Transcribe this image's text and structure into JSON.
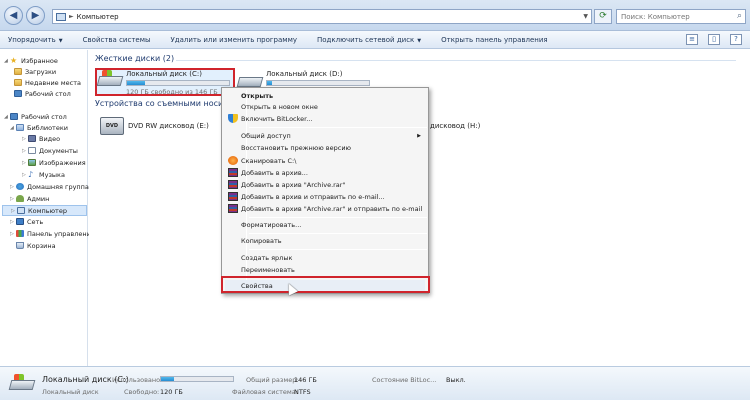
{
  "address_bar": {
    "arrow": "►",
    "path": "Компьютер",
    "search_placeholder": "Поиск: Компьютер"
  },
  "toolbar": {
    "items": [
      {
        "label": "Упорядочить",
        "has_dropdown": true
      },
      {
        "label": "Свойства системы"
      },
      {
        "label": "Удалить или изменить программу"
      },
      {
        "label": "Подключить сетевой диск",
        "has_dropdown": true
      },
      {
        "label": "Открыть панель управления"
      }
    ]
  },
  "sidebar": {
    "favorites": "Избранное",
    "downloads": "Загрузки",
    "recent_places": "Недавние места",
    "desktop_fav": "Рабочий стол",
    "desktop": "Рабочий стол",
    "libraries": "Библиотеки",
    "video": "Видео",
    "documents": "Документы",
    "images": "Изображения",
    "music": "Музыка",
    "homegroup": "Домашняя группа",
    "admin": "Админ",
    "computer": "Компьютер",
    "network": "Сеть",
    "control_panel": "Панель управления",
    "recycle_bin": "Корзина"
  },
  "main": {
    "hard_disks_title": "Жесткие диски (2)",
    "removable_title": "Устройства со съемными носит",
    "drive_c": {
      "name": "Локальный диск (C:)",
      "free_text": "120 ГБ свободно из 146 ГБ",
      "used_fraction": 0.18
    },
    "drive_d": {
      "name": "Локальный диск (D:)",
      "used_fraction": 0.05
    },
    "dvd": {
      "name": "DVD RW дисковод (E:)",
      "badge": "DVD"
    },
    "drive_h_partial": "дисковод (H:)"
  },
  "context_menu": {
    "open": "Открыть",
    "open_new_window": "Открыть в новом окне",
    "bitlocker": "Включить BitLocker...",
    "share": "Общий доступ",
    "restore": "Восстановить прежнюю версию",
    "scan": "Сканировать C:\\",
    "add_archive": "Добавить в архив...",
    "add_archive_rar": "Добавить в архив \"Archive.rar\"",
    "add_archive_email": "Добавить в архив и отправить по e-mail...",
    "add_archive_rar_email": "Добавить в архив \"Archive.rar\" и отправить по e-mail",
    "format": "Форматировать...",
    "copy": "Копировать",
    "create_shortcut": "Создать ярлык",
    "rename": "Переименовать",
    "properties": "Свойства"
  },
  "details": {
    "name": "Локальный диск (C:)",
    "drive_type": "Локальный диск",
    "used_label": "Использовано:",
    "used_fraction": 0.18,
    "free_label": "Свободно:",
    "free_value": "120 ГБ",
    "total_label": "Общий размер:",
    "total_value": "146 ГБ",
    "fs_label": "Файловая система:",
    "fs_value": "NTFS",
    "bitlocker_label": "Состояние BitLoc...",
    "bitlocker_value": "Выкл."
  }
}
